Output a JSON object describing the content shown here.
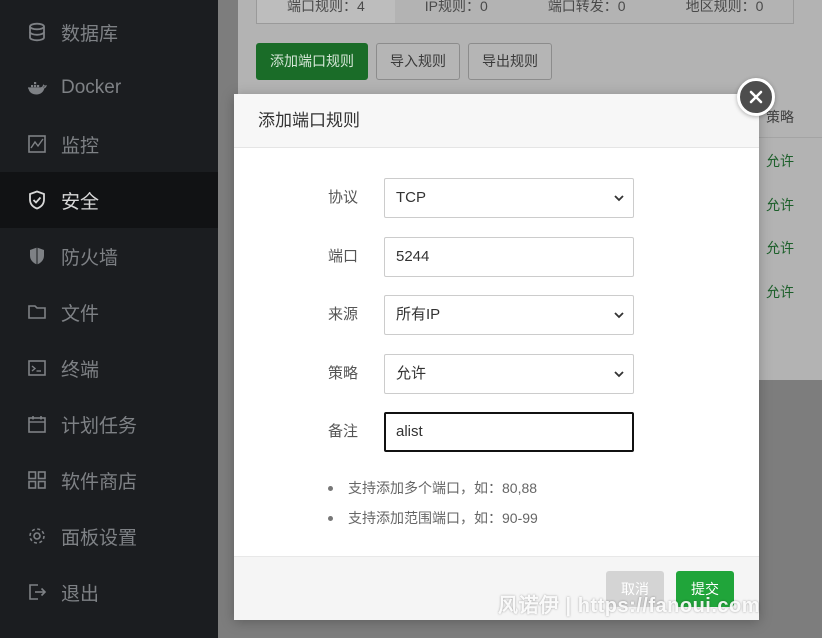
{
  "sidebar": {
    "items": [
      {
        "label": "数据库",
        "icon": "database-icon",
        "active": false
      },
      {
        "label": "Docker",
        "icon": "docker-icon",
        "active": false
      },
      {
        "label": "监控",
        "icon": "monitor-icon",
        "active": false
      },
      {
        "label": "安全",
        "icon": "shield-icon",
        "active": true
      },
      {
        "label": "防火墙",
        "icon": "firewall-icon",
        "active": false
      },
      {
        "label": "文件",
        "icon": "folder-icon",
        "active": false
      },
      {
        "label": "终端",
        "icon": "terminal-icon",
        "active": false
      },
      {
        "label": "计划任务",
        "icon": "calendar-icon",
        "active": false
      },
      {
        "label": "软件商店",
        "icon": "grid-icon",
        "active": false
      },
      {
        "label": "面板设置",
        "icon": "gear-icon",
        "active": false
      },
      {
        "label": "退出",
        "icon": "logout-icon",
        "active": false
      }
    ]
  },
  "tabs": [
    {
      "label": "端口规则：4"
    },
    {
      "label": "IP规则：0"
    },
    {
      "label": "端口转发：0"
    },
    {
      "label": "地区规则：0"
    }
  ],
  "toolbar": {
    "add_label": "添加端口规则",
    "import_label": "导入规则",
    "export_label": "导出规则"
  },
  "table": {
    "header_strategy": "策略",
    "rows": [
      {
        "strategy": "允许"
      },
      {
        "strategy": "允许"
      },
      {
        "strategy": "允许"
      },
      {
        "strategy": "允许"
      }
    ]
  },
  "modal": {
    "title": "添加端口规则",
    "protocol": {
      "label": "协议",
      "value": "TCP"
    },
    "port": {
      "label": "端口",
      "value": "5244"
    },
    "source": {
      "label": "来源",
      "value": "所有IP"
    },
    "strategy": {
      "label": "策略",
      "value": "允许"
    },
    "remark": {
      "label": "备注",
      "value": "alist"
    },
    "hints": [
      "支持添加多个端口，如：80,88",
      "支持添加范围端口，如：90-99"
    ],
    "cancel_label": "取消",
    "submit_label": "提交"
  },
  "watermark": "风诺伊 | https://fanoui.com",
  "colors": {
    "accent": "#20a53a",
    "sidebar_bg": "#1b1d20",
    "allow_text": "#1c5f2a"
  }
}
